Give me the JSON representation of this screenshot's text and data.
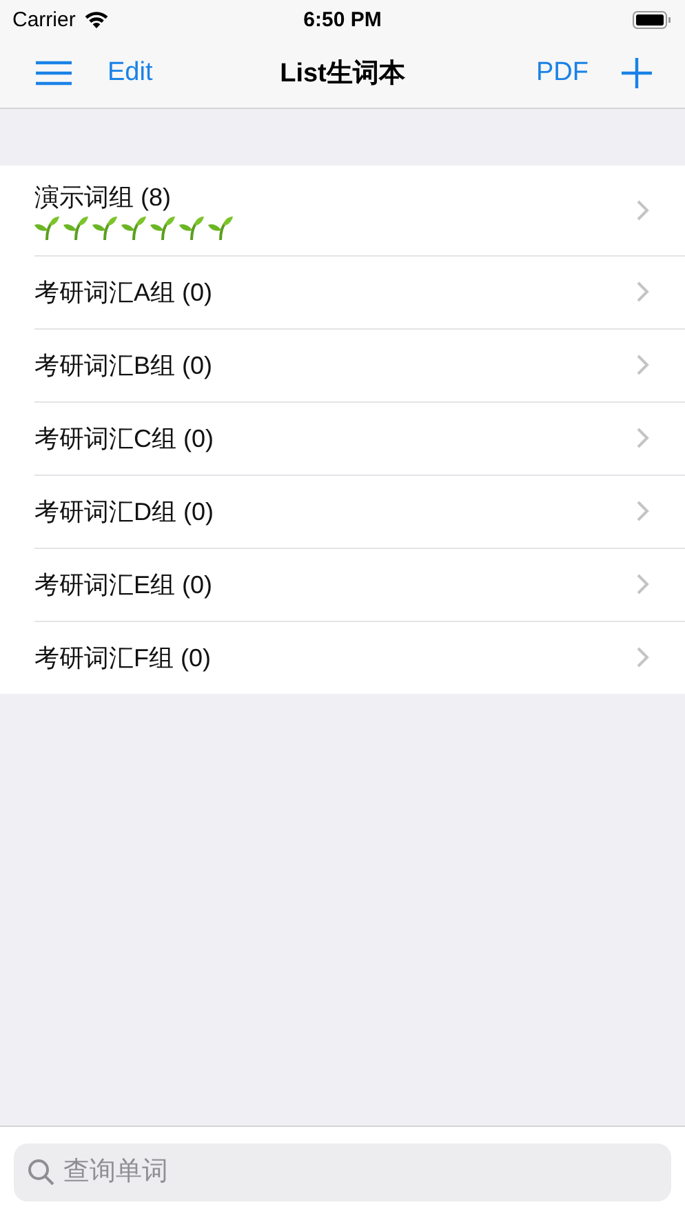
{
  "status_bar": {
    "carrier": "Carrier",
    "time": "6:50 PM"
  },
  "nav": {
    "left": "Edit",
    "title": "List生词本",
    "right": "PDF"
  },
  "groups": [
    {
      "title": "演示词组 (8)",
      "marks": [
        {
          "kind": "sprout"
        },
        {
          "kind": "sprout"
        },
        {
          "kind": "sprout"
        },
        {
          "kind": "sprout"
        },
        {
          "kind": "sprout"
        },
        {
          "kind": "sprout"
        },
        {
          "kind": "sprout"
        }
      ]
    },
    {
      "title": "考研词汇A组 (0)"
    },
    {
      "title": "考研词汇B组 (0)"
    },
    {
      "title": "考研词汇C组 (0)"
    },
    {
      "title": "考研词汇D组 (0)"
    },
    {
      "title": "考研词汇E组 (0)"
    },
    {
      "title": "考研词汇F组 (0)"
    }
  ],
  "search": {
    "placeholder": "查询单词"
  }
}
